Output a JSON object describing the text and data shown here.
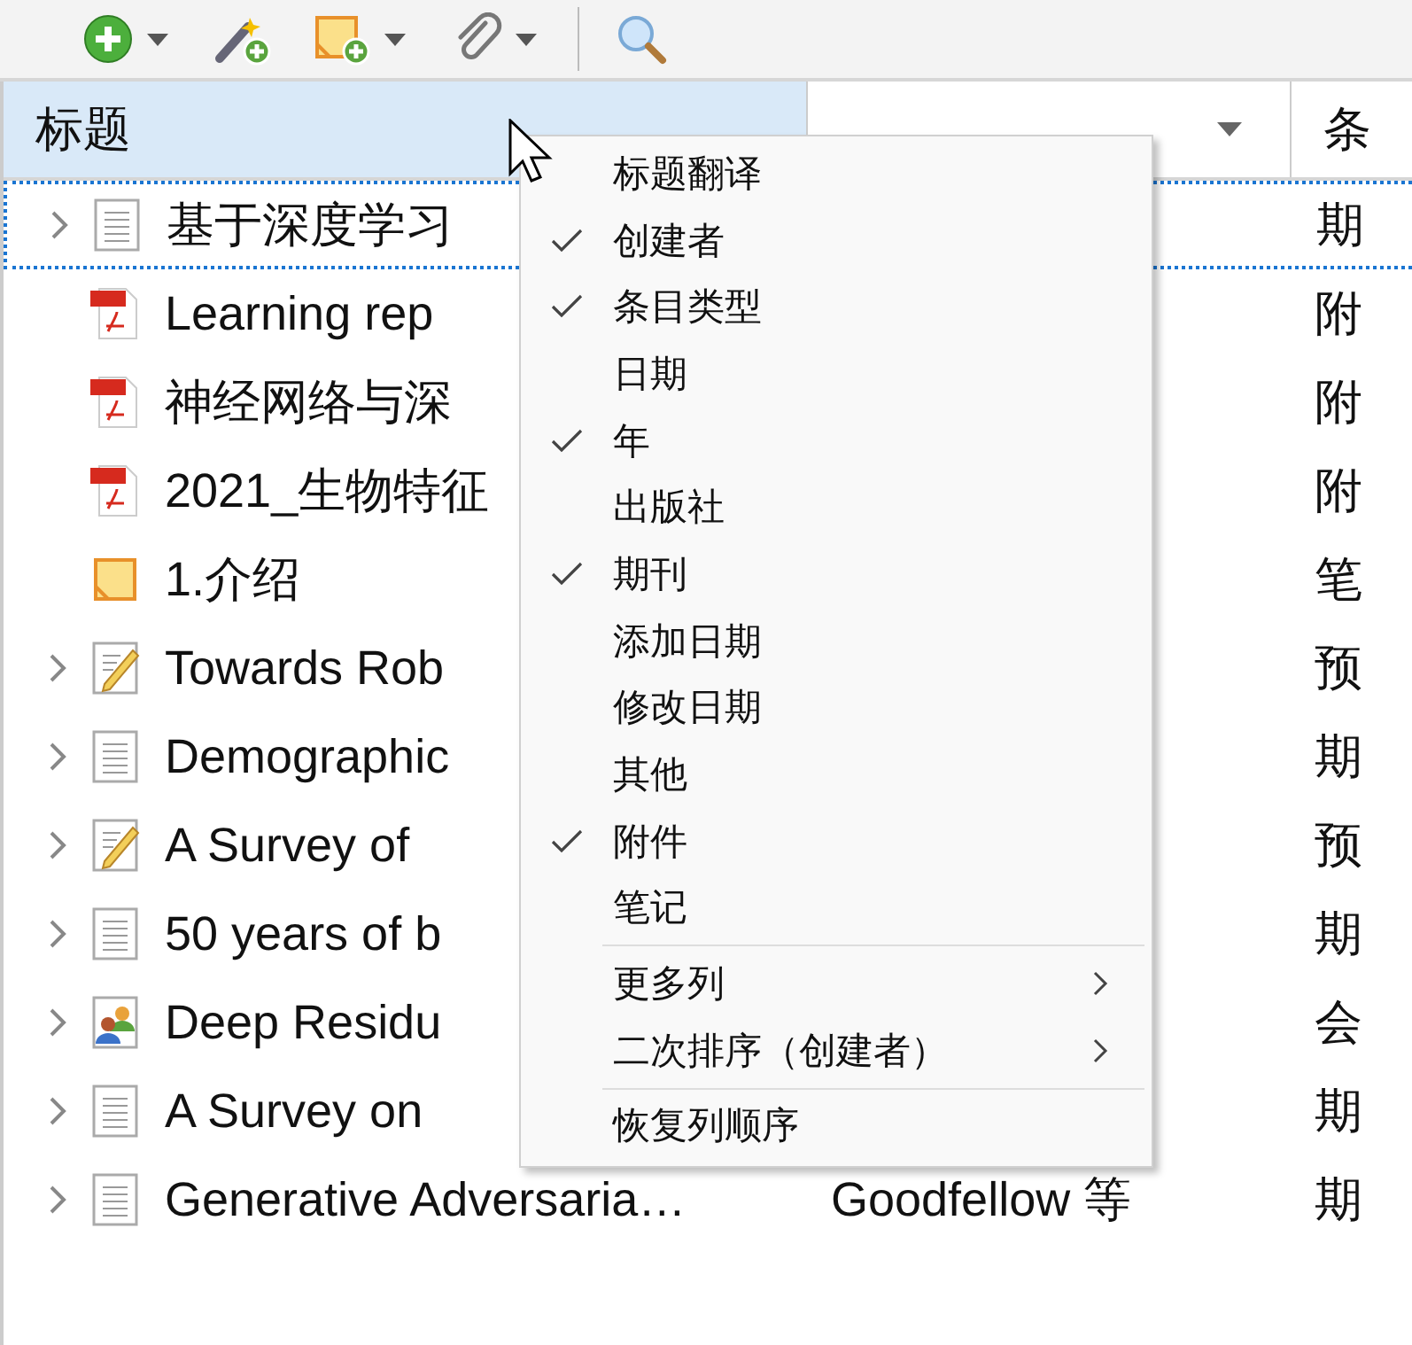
{
  "toolbar": {
    "buttons": [
      {
        "kind": "add",
        "dropdown": true
      },
      {
        "kind": "wand",
        "dropdown": false
      },
      {
        "kind": "note",
        "dropdown": true
      },
      {
        "kind": "attach",
        "dropdown": true
      },
      {
        "kind": "separator"
      },
      {
        "kind": "search",
        "dropdown": false
      }
    ]
  },
  "table": {
    "columns": [
      {
        "label": "标题",
        "selected": true,
        "sorted": false
      },
      {
        "selected": false,
        "sorted": true
      },
      {
        "label": "条",
        "selected": false,
        "sorted": false
      }
    ],
    "rows": [
      {
        "kind": "document",
        "has_children": true,
        "focused": true,
        "title": "基于深度学习",
        "type": "期"
      },
      {
        "kind": "pdf",
        "has_children": false,
        "focused": false,
        "title": "Learning rep",
        "type": "附"
      },
      {
        "kind": "pdf",
        "has_children": false,
        "focused": false,
        "title": "神经网络与深",
        "type": "附"
      },
      {
        "kind": "pdf",
        "has_children": false,
        "focused": false,
        "title": "2021_生物特征",
        "type": "附"
      },
      {
        "kind": "note",
        "has_children": false,
        "focused": false,
        "title": "1.介绍",
        "type": "笔"
      },
      {
        "kind": "preprint",
        "has_children": true,
        "focused": false,
        "title": "Towards Rob",
        "type": "预"
      },
      {
        "kind": "document",
        "has_children": true,
        "focused": false,
        "title": "Demographic",
        "type": "期"
      },
      {
        "kind": "preprint",
        "has_children": true,
        "focused": false,
        "title": "A Survey of",
        "type": "预"
      },
      {
        "kind": "document",
        "has_children": true,
        "focused": false,
        "title": "50 years of b",
        "type": "期"
      },
      {
        "kind": "conference",
        "has_children": true,
        "focused": false,
        "title": "Deep Residu",
        "type": "会"
      },
      {
        "kind": "document",
        "has_children": true,
        "focused": false,
        "title": "A Survey on",
        "type": "期"
      },
      {
        "kind": "document",
        "has_children": true,
        "focused": false,
        "title": "Generative Adversaria…",
        "creator": "Goodfellow 等",
        "type": "期"
      }
    ]
  },
  "context_menu": {
    "items": [
      {
        "kind": "check",
        "label": "标题翻译",
        "checked": false
      },
      {
        "kind": "check",
        "label": "创建者",
        "checked": true
      },
      {
        "kind": "check",
        "label": "条目类型",
        "checked": true
      },
      {
        "kind": "check",
        "label": "日期",
        "checked": false
      },
      {
        "kind": "check",
        "label": "年",
        "checked": true
      },
      {
        "kind": "check",
        "label": "出版社",
        "checked": false
      },
      {
        "kind": "check",
        "label": "期刊",
        "checked": true
      },
      {
        "kind": "check",
        "label": "添加日期",
        "checked": false
      },
      {
        "kind": "check",
        "label": "修改日期",
        "checked": false
      },
      {
        "kind": "check",
        "label": "其他",
        "checked": false
      },
      {
        "kind": "check",
        "label": "附件",
        "checked": true
      },
      {
        "kind": "check",
        "label": "笔记",
        "checked": false
      },
      {
        "kind": "separator"
      },
      {
        "kind": "submenu",
        "label": "更多列"
      },
      {
        "kind": "submenu",
        "label": "二次排序（创建者）"
      },
      {
        "kind": "separator"
      },
      {
        "kind": "action",
        "label": "恢复列顺序"
      }
    ]
  }
}
